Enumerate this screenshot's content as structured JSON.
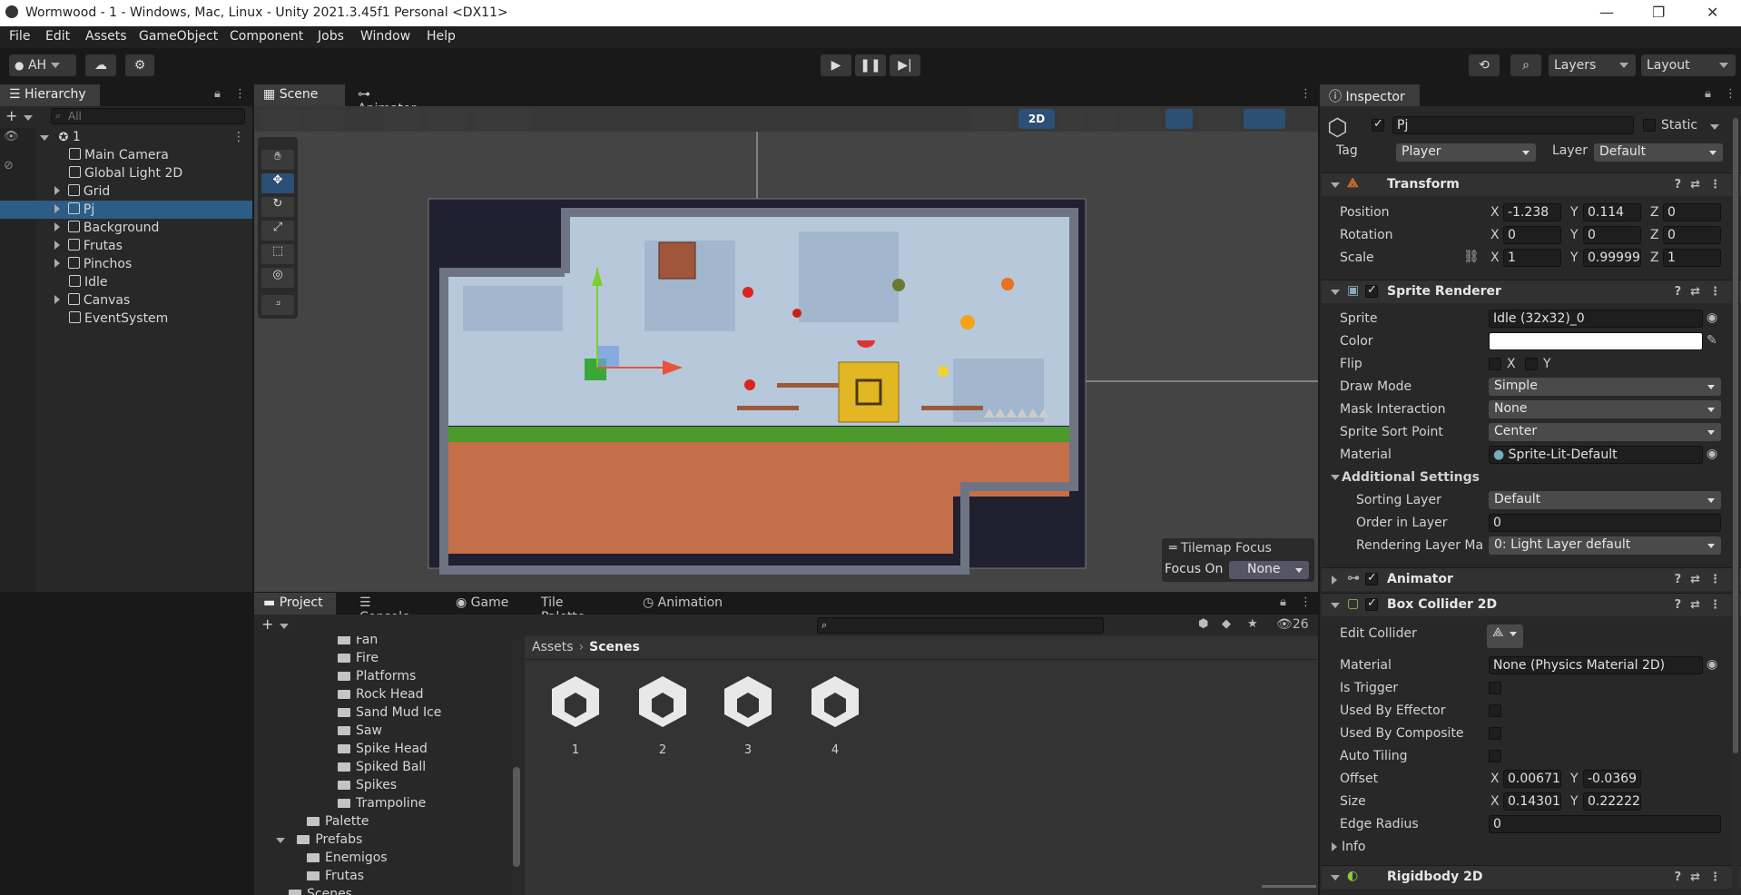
{
  "window": {
    "title": "Wormwood - 1 - Windows, Mac, Linux - Unity 2021.3.45f1 Personal <DX11>"
  },
  "menu": [
    "File",
    "Edit",
    "Assets",
    "GameObject",
    "Component",
    "Jobs",
    "Window",
    "Help"
  ],
  "toolbar": {
    "account": "AH",
    "layers": "Layers",
    "layout": "Layout"
  },
  "hierarchy": {
    "tab": "Hierarchy",
    "search_placeholder": "All",
    "scene": "1",
    "items": [
      "Main Camera",
      "Global Light 2D",
      "Grid",
      "Pj",
      "Background",
      "Frutas",
      "Pinchos",
      "Idle",
      "Canvas",
      "EventSystem"
    ]
  },
  "scene_view": {
    "tabs": [
      "Scene",
      "Animator"
    ],
    "mode_2d": "2D",
    "overlay": {
      "title": "Tilemap Focus",
      "focus_label": "Focus On",
      "focus_value": "None"
    }
  },
  "project": {
    "tabs": [
      "Project",
      "Console",
      "Game",
      "Tile Palette",
      "Animation"
    ],
    "count": "26",
    "folders": [
      "Fan",
      "Fire",
      "Platforms",
      "Rock Head",
      "Sand Mud Ice",
      "Saw",
      "Spike Head",
      "Spiked Ball",
      "Spikes",
      "Trampoline",
      "Palette",
      "Prefabs",
      "Enemigos",
      "Frutas",
      "Scenes"
    ],
    "breadcrumb": [
      "Assets",
      "Scenes"
    ],
    "assets": [
      "1",
      "2",
      "3",
      "4"
    ]
  },
  "inspector": {
    "tab": "Inspector",
    "name": "Pj",
    "static": "Static",
    "tag_label": "Tag",
    "tag": "Player",
    "layer_label": "Layer",
    "layer": "Default",
    "transform": {
      "title": "Transform",
      "position": {
        "label": "Position",
        "x": "-1.238",
        "y": "0.114",
        "z": "0"
      },
      "rotation": {
        "label": "Rotation",
        "x": "0",
        "y": "0",
        "z": "0"
      },
      "scale": {
        "label": "Scale",
        "x": "1",
        "y": "0.99999",
        "z": "1"
      }
    },
    "sprite_renderer": {
      "title": "Sprite Renderer",
      "sprite_label": "Sprite",
      "sprite": "Idle (32x32)_0",
      "color_label": "Color",
      "flip_label": "Flip",
      "draw_mode_label": "Draw Mode",
      "draw_mode": "Simple",
      "mask_label": "Mask Interaction",
      "mask": "None",
      "sort_point_label": "Sprite Sort Point",
      "sort_point": "Center",
      "material_label": "Material",
      "material": "Sprite-Lit-Default",
      "additional": "Additional Settings",
      "sorting_layer_label": "Sorting Layer",
      "sorting_layer": "Default",
      "order_label": "Order in Layer",
      "order": "0",
      "rendering_label": "Rendering Layer Ma",
      "rendering": "0: Light Layer default"
    },
    "animator": {
      "title": "Animator"
    },
    "box_collider": {
      "title": "Box Collider 2D",
      "edit_label": "Edit Collider",
      "material_label": "Material",
      "material": "None (Physics Material 2D)",
      "trigger_label": "Is Trigger",
      "effector_label": "Used By Effector",
      "composite_label": "Used By Composite",
      "tiling_label": "Auto Tiling",
      "offset_label": "Offset",
      "offset_x": "0.00671",
      "offset_y": "-0.0369",
      "size_label": "Size",
      "size_x": "0.14301",
      "size_y": "0.22222",
      "edge_label": "Edge Radius",
      "edge": "0",
      "info_label": "Info"
    },
    "rigidbody": {
      "title": "Rigidbody 2D"
    }
  }
}
